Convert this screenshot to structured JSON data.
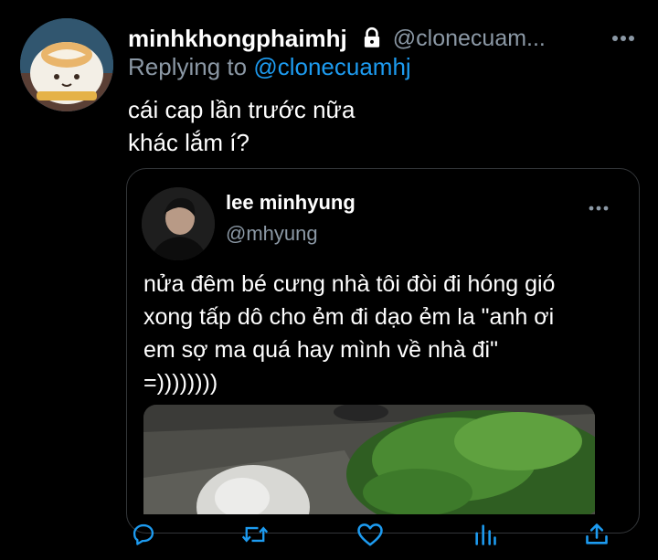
{
  "tweet": {
    "display_name": "minhkhongphaimhj",
    "handle": "@clonecuam...",
    "replying_prefix": "Replying to ",
    "replying_handle": "@clonecuamhj",
    "text": "cái cap lần trước nữa\nkhác lắm í?",
    "is_protected": true
  },
  "quoted_tweet": {
    "display_name": "lee minhyung",
    "handle": "@mhyung",
    "text": "nửa đêm bé cưng nhà tôi đòi đi hóng gió\nxong tấp dô cho ẻm đi dạo ẻm la \"anh ơi\nem sợ ma quá hay mình về nhà đi\"\n=))))))))"
  },
  "actions": [
    {
      "name": "reply",
      "icon": "reply-icon"
    },
    {
      "name": "retweet",
      "icon": "retweet-icon"
    },
    {
      "name": "like",
      "icon": "heart-icon"
    },
    {
      "name": "analytics",
      "icon": "analytics-icon"
    },
    {
      "name": "share",
      "icon": "share-icon"
    }
  ],
  "colors": {
    "background": "#000000",
    "secondary_text": "#8b98a5",
    "accent": "#1d9bf0",
    "border": "#333639",
    "icon": "#1d9bf0"
  }
}
